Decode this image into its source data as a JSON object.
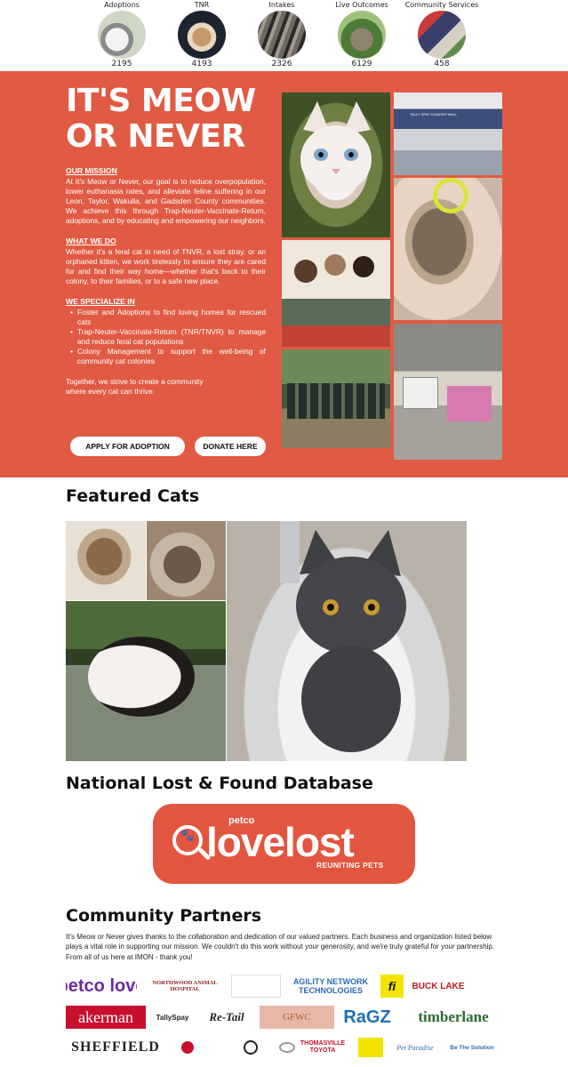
{
  "stats": [
    {
      "label": "Adoptions",
      "count": "2195"
    },
    {
      "label": "TNR",
      "count": "4193"
    },
    {
      "label": "Intakes",
      "count": "2326"
    },
    {
      "label": "Live Outcomes",
      "count": "6129"
    },
    {
      "label": "Community Services",
      "count": "458"
    }
  ],
  "hero": {
    "title_line1": "IT'S MEOW",
    "title_line2": "OR NEVER",
    "mission_heading": "OUR MISSION",
    "mission_text": "At It's Meow or Never, our goal is to reduce overpopulation, lower euthanasia rates, and alleviate feline suffering in our Leon, Taylor, Wakulla, and Gadsden County communities. We achieve this through Trap-Neuter-Vaccinate-Return, adoptions, and by educating and empowering our neighbors.",
    "whatwedo_heading": "WHAT WE DO",
    "whatwedo_text": "Whether it's a feral cat in need of TNVR, a lost stray, or an orphaned kitten, we work tirelessly to ensure they are cared for and find their way home—whether that's back to their colony, to their families, or to a safe new place.",
    "specialize_heading": "WE SPECIALIZE IN",
    "specialties": [
      "Foster and Adoptions to find loving homes for rescued cats",
      "Trap-Neuter-Vaccinate-Return (TNR/TNVR) to manage and reduce feral cat populations",
      "Colony Management to support the well-being of community cat colonies"
    ],
    "closing_line1": "Together, we strive to create a community",
    "closing_line2": "where every cat can thrive.",
    "apply_button": "APPLY FOR ADOPTION",
    "donate_button": "DONATE HERE",
    "banner_text": "TALLY SPAY HONORS WALL"
  },
  "featured": {
    "heading": "Featured Cats"
  },
  "lostfound": {
    "heading": "National Lost & Found Database",
    "logo_small": "petco",
    "logo_word": "lovelost",
    "logo_sub": "REUNITING PETS"
  },
  "partners": {
    "heading": "Community Partners",
    "text": "It's Meow or Never gives thanks to the collaboration and dedication of our valued partners. Each business and organization listed below plays a vital role in supporting our mission. We couldn't do this work without your generosity, and we're truly grateful for your partnership. From all of us here at IMON - thank you!",
    "logos": [
      {
        "text": "petco love",
        "color": "#6a2ca0"
      },
      {
        "text": "NORTHWOOD ANIMAL HOSPITAL",
        "color": "#8b1a1a"
      },
      {
        "text": "",
        "color": "#999999"
      },
      {
        "text": "AGILITY NETWORK TECHNOLOGIES",
        "color": "#2a6bb5"
      },
      {
        "text": "fi",
        "color": "#111111"
      },
      {
        "text": "BUCK LAKE",
        "color": "#b81d24"
      },
      {
        "text": "",
        "color": "#999999"
      },
      {
        "text": "akerman",
        "color": "#c8102e"
      },
      {
        "text": "TallySpay",
        "color": "#222222"
      },
      {
        "text": "Re-Tail",
        "color": "#222222"
      },
      {
        "text": "GFWC",
        "color": "#b65a3b"
      },
      {
        "text": "RaGZ",
        "color": "#1f6fb3"
      },
      {
        "text": "timberlane",
        "color": "#2d6b2e"
      },
      {
        "text": "SHEFFIELD",
        "color": "#222222"
      },
      {
        "text": "THOMASVILLE TOYOTA",
        "color": "#c8102e"
      },
      {
        "text": "Pet Paradise",
        "color": "#2a6bb5"
      },
      {
        "text": "Be The Solution",
        "color": "#2a6bb5"
      }
    ]
  }
}
